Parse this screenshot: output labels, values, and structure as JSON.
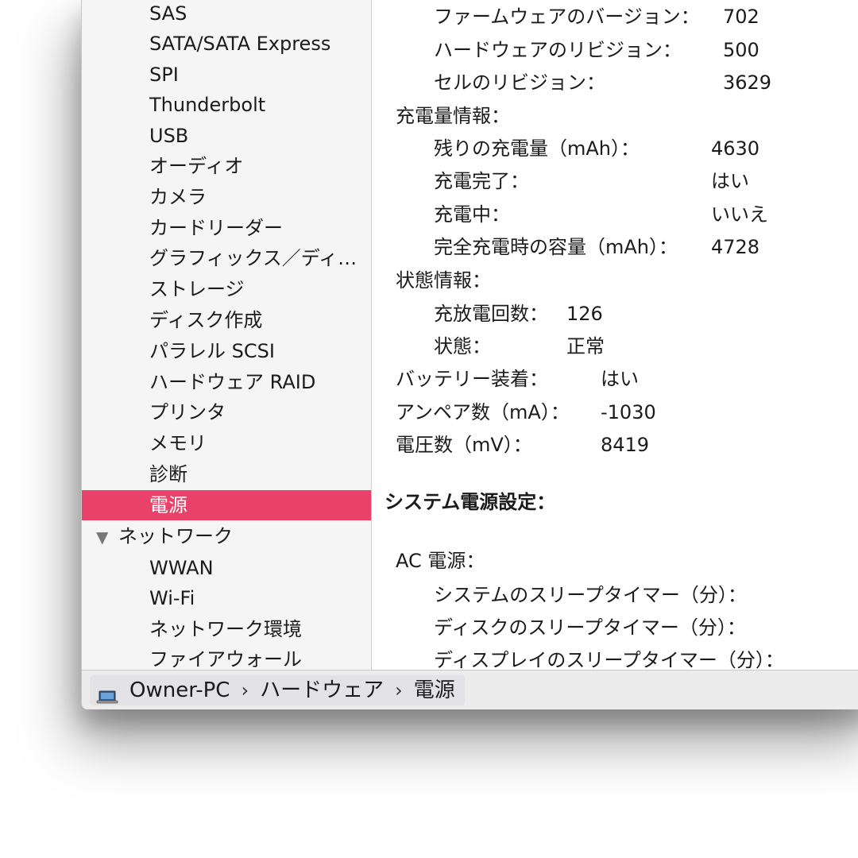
{
  "sidebar": {
    "hardware_items": [
      "SAS",
      "SATA/SATA Express",
      "SPI",
      "Thunderbolt",
      "USB",
      "オーディオ",
      "カメラ",
      "カードリーダー",
      "グラフィックス／ディ…",
      "ストレージ",
      "ディスク作成",
      "パラレル SCSI",
      "ハードウェア RAID",
      "プリンタ",
      "メモリ",
      "診断",
      "電源"
    ],
    "selected_item": "電源",
    "network_group": "ネットワーク",
    "network_items": [
      "WWAN",
      "Wi-Fi",
      "ネットワーク環境",
      "ファイアウォール"
    ]
  },
  "content": {
    "firmware": {
      "label": "ファームウェアのバージョン：",
      "value": "702"
    },
    "hardware_rev": {
      "label": "ハードウェアのリビジョン：",
      "value": "500"
    },
    "cell_rev": {
      "label": "セルのリビジョン：",
      "value": "3629"
    },
    "charge_info_heading": "充電量情報：",
    "remaining": {
      "label": "残りの充電量（mAh）：",
      "value": "4630"
    },
    "fully_charged": {
      "label": "充電完了：",
      "value": "はい"
    },
    "charging": {
      "label": "充電中：",
      "value": "いいえ"
    },
    "full_capacity": {
      "label": "完全充電時の容量（mAh）：",
      "value": "4728"
    },
    "health_heading": "状態情報：",
    "cycle_count": {
      "label": "充放電回数：",
      "value": "126"
    },
    "condition": {
      "label": "状態：",
      "value": "正常"
    },
    "battery_installed": {
      "label": "バッテリー装着：",
      "value": "はい"
    },
    "amperage": {
      "label": "アンペア数（mA）：",
      "value": "-1030"
    },
    "voltage": {
      "label": "電圧数（mV）：",
      "value": "8419"
    },
    "system_power_heading": "システム電源設定：",
    "ac_power_heading": "AC 電源：",
    "system_sleep": "システムのスリープタイマー（分）：",
    "disk_sleep": "ディスクのスリープタイマー（分）：",
    "display_sleep": "ディスプレイのスリープタイマー（分）："
  },
  "statusbar": {
    "computer": "Owner-PC",
    "separator": "›",
    "category": "ハードウェア",
    "item": "電源",
    "icon": "laptop-icon"
  },
  "colors": {
    "selection": "#e8416a"
  }
}
